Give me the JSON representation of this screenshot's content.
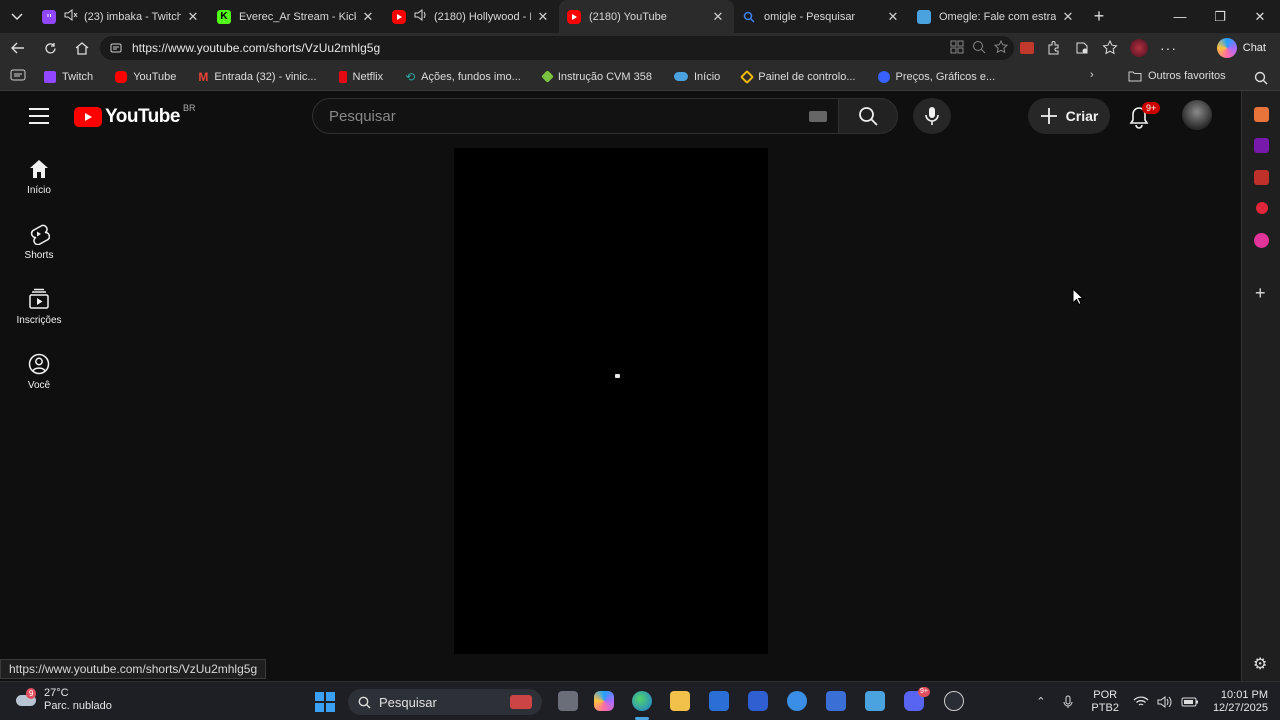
{
  "browser": {
    "tabs": [
      {
        "title": "(23) imbaka - Twitch",
        "favicon": "twitch-icon",
        "color": "#9146ff",
        "muted": true
      },
      {
        "title": "Everec_Ar Stream - Kick D",
        "favicon": "kick-icon",
        "color": "#53fc18"
      },
      {
        "title": "(2180) Hollywood - Pe",
        "favicon": "youtube-icon",
        "color": "#ff0000",
        "audio": true
      },
      {
        "title": "(2180) YouTube",
        "favicon": "youtube-icon",
        "color": "#ff0000",
        "active": true
      },
      {
        "title": "omigle - Pesquisar",
        "favicon": "search-icon",
        "color": "#3b82f6"
      },
      {
        "title": "Omegle: Fale com estranh",
        "favicon": "omegle-icon",
        "color": "#4aa3df"
      }
    ],
    "url": "https://www.youtube.com/shorts/VzUu2mhlg5g",
    "chat_label": "Chat",
    "favorites": [
      {
        "label": "Twitch",
        "icon": "twitch-icon",
        "color": "#9146ff"
      },
      {
        "label": "YouTube",
        "icon": "youtube-icon",
        "color": "#ff0000"
      },
      {
        "label": "Entrada (32) - vinic...",
        "icon": "gmail-icon",
        "color": "#ea4335"
      },
      {
        "label": "Netflix",
        "icon": "netflix-icon",
        "color": "#e50914"
      },
      {
        "label": "Ações, fundos imo...",
        "icon": "chart-icon",
        "color": "#2ba4a0"
      },
      {
        "label": "Instrução CVM 358",
        "icon": "diamond-icon",
        "color": "#7cc242"
      },
      {
        "label": "Início",
        "icon": "cloud-icon",
        "color": "#4aa3df"
      },
      {
        "label": "Painel de controlo...",
        "icon": "binance-icon",
        "color": "#f0b90b"
      },
      {
        "label": "Preços, Gráficos e...",
        "icon": "coinmarketcap-icon",
        "color": "#3861fb"
      }
    ],
    "other_favorites_label": "Outros favoritos",
    "status_url": "https://www.youtube.com/shorts/VzUu2mhlg5g"
  },
  "youtube": {
    "logo_text": "YouTube",
    "country_code": "BR",
    "search_placeholder": "Pesquisar",
    "create_label": "Criar",
    "notification_badge": "9+",
    "sidebar": [
      {
        "label": "Início",
        "icon": "home-icon"
      },
      {
        "label": "Shorts",
        "icon": "shorts-icon"
      },
      {
        "label": "Inscrições",
        "icon": "subscriptions-icon"
      },
      {
        "label": "Você",
        "icon": "you-icon"
      }
    ]
  },
  "taskbar": {
    "temperature": "27°C",
    "weather": "Parc. nublado",
    "weather_badge": "9",
    "search_placeholder": "Pesquisar",
    "lang_1": "POR",
    "lang_2": "PTB2",
    "time": "10:01 PM",
    "date": "12/27/2025",
    "discord_badge": "9+"
  }
}
